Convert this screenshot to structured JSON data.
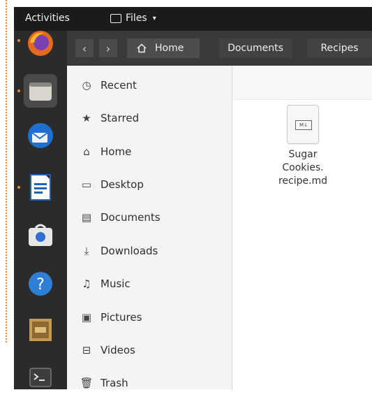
{
  "topbar": {
    "activities": "Activities",
    "app_menu": "Files",
    "caret": "▾"
  },
  "dock": {
    "apps": [
      {
        "name": "Firefox",
        "icon": "firefox-icon",
        "running": true
      },
      {
        "name": "Files",
        "icon": "files-icon",
        "running": true,
        "active": true
      },
      {
        "name": "Thunderbird",
        "icon": "thunderbird-icon",
        "running": false
      },
      {
        "name": "LibreOffice Writer",
        "icon": "writer-icon",
        "running": true
      },
      {
        "name": "Software",
        "icon": "software-icon",
        "running": false
      },
      {
        "name": "Help",
        "icon": "help-icon",
        "running": false
      },
      {
        "name": "DOSBox",
        "icon": "dosbox-icon",
        "running": false
      },
      {
        "name": "Terminal",
        "icon": "terminal-icon",
        "running": false
      }
    ]
  },
  "headerbar": {
    "back": "‹",
    "forward": "›",
    "breadcrumbs": [
      "Home",
      "Documents",
      "Recipes"
    ]
  },
  "sidebar": {
    "items": [
      {
        "label": "Recent",
        "icon": "clock-icon",
        "glyph": "◷"
      },
      {
        "label": "Starred",
        "icon": "star-icon",
        "glyph": "★"
      },
      {
        "label": "Home",
        "icon": "home-icon",
        "glyph": "⌂"
      },
      {
        "label": "Desktop",
        "icon": "desktop-icon",
        "glyph": "▭"
      },
      {
        "label": "Documents",
        "icon": "documents-icon",
        "glyph": "▤"
      },
      {
        "label": "Downloads",
        "icon": "download-icon",
        "glyph": "⤓"
      },
      {
        "label": "Music",
        "icon": "music-icon",
        "glyph": "♫"
      },
      {
        "label": "Pictures",
        "icon": "pictures-icon",
        "glyph": "▣"
      },
      {
        "label": "Videos",
        "icon": "videos-icon",
        "glyph": "⊟"
      },
      {
        "label": "Trash",
        "icon": "trash-icon",
        "glyph": "🗑"
      }
    ]
  },
  "content": {
    "files": [
      {
        "name_lines": [
          "Sugar",
          "Cookies.",
          "recipe.md"
        ],
        "badge": "M↓"
      }
    ]
  },
  "colors": {
    "accent": "#e8893a",
    "topbar": "#1b1b1b",
    "dock": "#2b2b2b",
    "headerbar": "#3a3a3a",
    "sidebar": "#f4f4f4"
  }
}
